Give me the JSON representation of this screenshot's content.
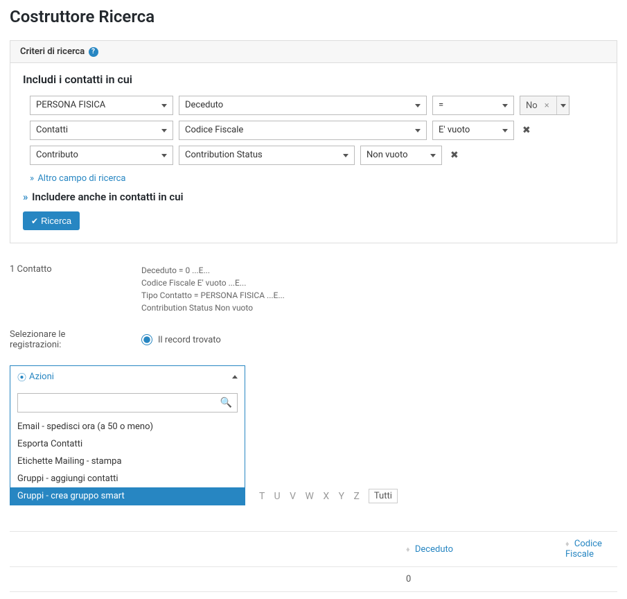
{
  "page_title": "Costruttore Ricerca",
  "panel": {
    "heading": "Criteri di ricerca",
    "include_heading": "Includi i contatti in cui"
  },
  "criteria": [
    {
      "c1": "PERSONA FISICA",
      "c2": "Deceduto",
      "op": "=",
      "val": "No"
    },
    {
      "c1": "Contatti",
      "c2": "Codice Fiscale",
      "op": "E' vuoto"
    },
    {
      "c1": "Contributo",
      "c2": "Contribution Status",
      "op": "Non vuoto"
    }
  ],
  "links": {
    "add_field": "Altro campo di ricerca",
    "include_also": "Includere anche in contatti in cui"
  },
  "search_button": "Ricerca",
  "results": {
    "count_label": "1 Contatto",
    "summary": [
      "Deceduto = 0 ...E...",
      "Codice Fiscale E' vuoto ...E...",
      "Tipo Contatto = PERSONA FISICA ...E...",
      "Contribution Status Non vuoto"
    ],
    "select_label": "Selezionare le registrazioni:",
    "radio_label": "Il record trovato"
  },
  "actions": {
    "label": "Azioni",
    "options": [
      "Email - spedisci ora (a 50 o meno)",
      "Esporta Contatti",
      "Etichette Mailing - stampa",
      "Gruppi - aggiungi contatti",
      "Gruppi - crea gruppo smart"
    ],
    "selected_index": 4
  },
  "alpha": {
    "letters": "T U V W X Y Z",
    "all": "Tutti"
  },
  "table": {
    "headers": {
      "c2": "Deceduto",
      "c3": "Codice Fiscale"
    },
    "rows": [
      {
        "c2": "0",
        "c3": ""
      }
    ]
  }
}
